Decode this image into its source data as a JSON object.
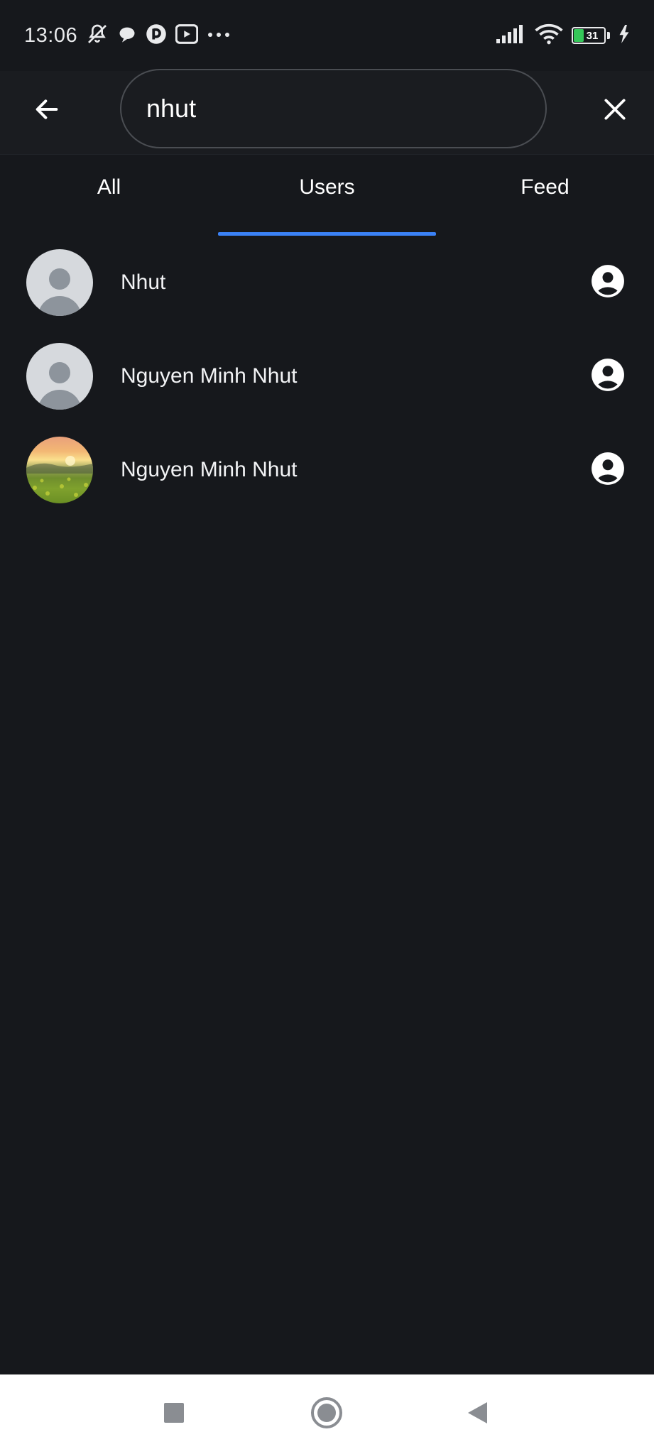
{
  "status_bar": {
    "time": "13:06",
    "left_icons": [
      "bell-off-icon",
      "chat-bubble-icon",
      "app-badge-icon",
      "video-player-icon",
      "more-dots-icon"
    ],
    "right_icons": [
      "signal-icon",
      "wifi-icon",
      "battery-icon",
      "charging-bolt-icon"
    ],
    "battery_level": "31"
  },
  "search": {
    "value": "nhut",
    "back_icon": "arrow-left-icon",
    "clear_icon": "close-icon"
  },
  "tabs": [
    {
      "label": "All",
      "active": false
    },
    {
      "label": "Users",
      "active": true
    },
    {
      "label": "Feed",
      "active": false
    }
  ],
  "accent_color": "#3b82f6",
  "users": [
    {
      "name": "Nhut",
      "avatar": "default-avatar",
      "action_icon": "account-circle-icon"
    },
    {
      "name": "Nguyen Minh Nhut",
      "avatar": "default-avatar",
      "action_icon": "account-circle-icon"
    },
    {
      "name": "Nguyen Minh Nhut",
      "avatar": "landscape-photo-avatar",
      "action_icon": "account-circle-icon"
    }
  ],
  "nav_bar": {
    "icons": [
      "recents-square-icon",
      "home-circle-icon",
      "back-triangle-icon"
    ]
  }
}
